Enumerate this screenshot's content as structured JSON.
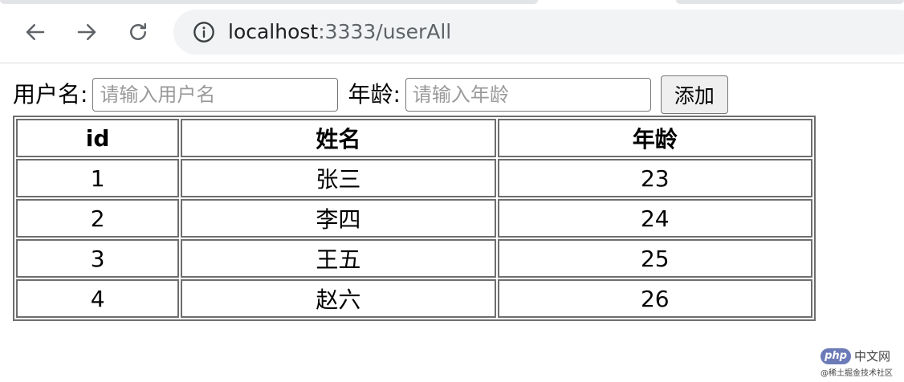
{
  "browser": {
    "url_host": "localhost",
    "url_rest": ":3333/userAll"
  },
  "form": {
    "username_label": "用户名:",
    "username_placeholder": "请输入用户名",
    "username_value": "",
    "age_label": "年龄:",
    "age_placeholder": "请输入年龄",
    "age_value": "",
    "add_button": "添加"
  },
  "table": {
    "headers": [
      "id",
      "姓名",
      "年龄"
    ],
    "rows": [
      [
        "1",
        "张三",
        "23"
      ],
      [
        "2",
        "李四",
        "24"
      ],
      [
        "3",
        "王五",
        "25"
      ],
      [
        "4",
        "赵六",
        "26"
      ]
    ]
  },
  "watermark": {
    "logo": "php",
    "text": "中文网",
    "sub": "@稀土掘金技术社区"
  },
  "icons": {
    "back": "back-arrow-icon",
    "forward": "forward-arrow-icon",
    "reload": "reload-icon",
    "info": "info-icon"
  }
}
